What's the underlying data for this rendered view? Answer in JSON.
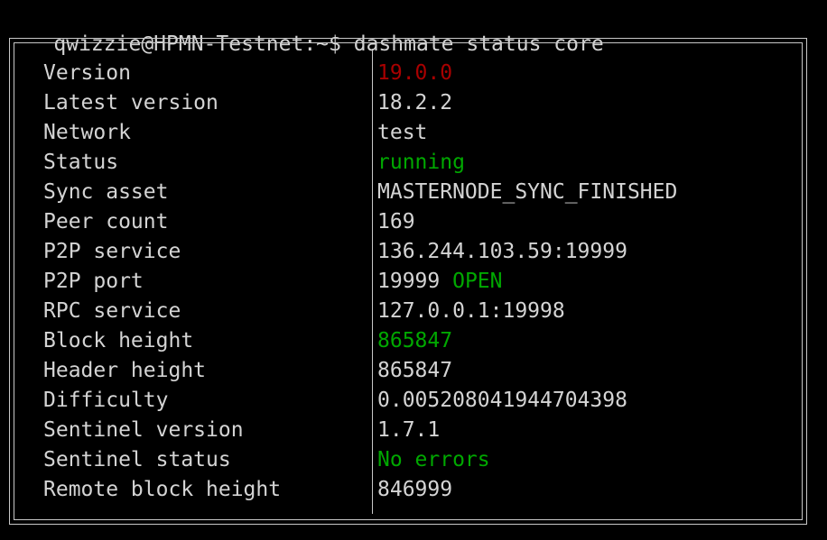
{
  "terminal": {
    "prompt": "qwizzie@HPMN-Testnet:~$",
    "command": "dashmate status core",
    "prompt_line": "qwizzie@HPMN-Testnet:~$ dashmate status core"
  },
  "colors": {
    "background": "#000000",
    "foreground": "#d4d4d4",
    "border": "#c8c8c8",
    "red": "#a80000",
    "green": "#00a800"
  },
  "status_table": {
    "rows": [
      {
        "label": "Version",
        "segments": [
          {
            "text": "19.0.0",
            "color": "red"
          }
        ]
      },
      {
        "label": "Latest version",
        "segments": [
          {
            "text": "18.2.2",
            "color": "plain"
          }
        ]
      },
      {
        "label": "Network",
        "segments": [
          {
            "text": "test",
            "color": "plain"
          }
        ]
      },
      {
        "label": "Status",
        "segments": [
          {
            "text": "running",
            "color": "green"
          }
        ]
      },
      {
        "label": "Sync asset",
        "segments": [
          {
            "text": "MASTERNODE_SYNC_FINISHED",
            "color": "plain"
          }
        ]
      },
      {
        "label": "Peer count",
        "segments": [
          {
            "text": "169",
            "color": "plain"
          }
        ]
      },
      {
        "label": "P2P service",
        "segments": [
          {
            "text": "136.244.103.59:19999",
            "color": "plain"
          }
        ]
      },
      {
        "label": "P2P port",
        "segments": [
          {
            "text": "19999 ",
            "color": "plain"
          },
          {
            "text": "OPEN",
            "color": "green"
          }
        ]
      },
      {
        "label": "RPC service",
        "segments": [
          {
            "text": "127.0.0.1:19998",
            "color": "plain"
          }
        ]
      },
      {
        "label": "Block height",
        "segments": [
          {
            "text": "865847",
            "color": "green"
          }
        ]
      },
      {
        "label": "Header height",
        "segments": [
          {
            "text": "865847",
            "color": "plain"
          }
        ]
      },
      {
        "label": "Difficulty",
        "segments": [
          {
            "text": "0.005208041944704398",
            "color": "plain"
          }
        ]
      },
      {
        "label": "Sentinel version",
        "segments": [
          {
            "text": "1.7.1",
            "color": "plain"
          }
        ]
      },
      {
        "label": "Sentinel status",
        "segments": [
          {
            "text": "No errors",
            "color": "green"
          }
        ]
      },
      {
        "label": "Remote block height",
        "segments": [
          {
            "text": "846999",
            "color": "plain"
          }
        ]
      }
    ]
  }
}
